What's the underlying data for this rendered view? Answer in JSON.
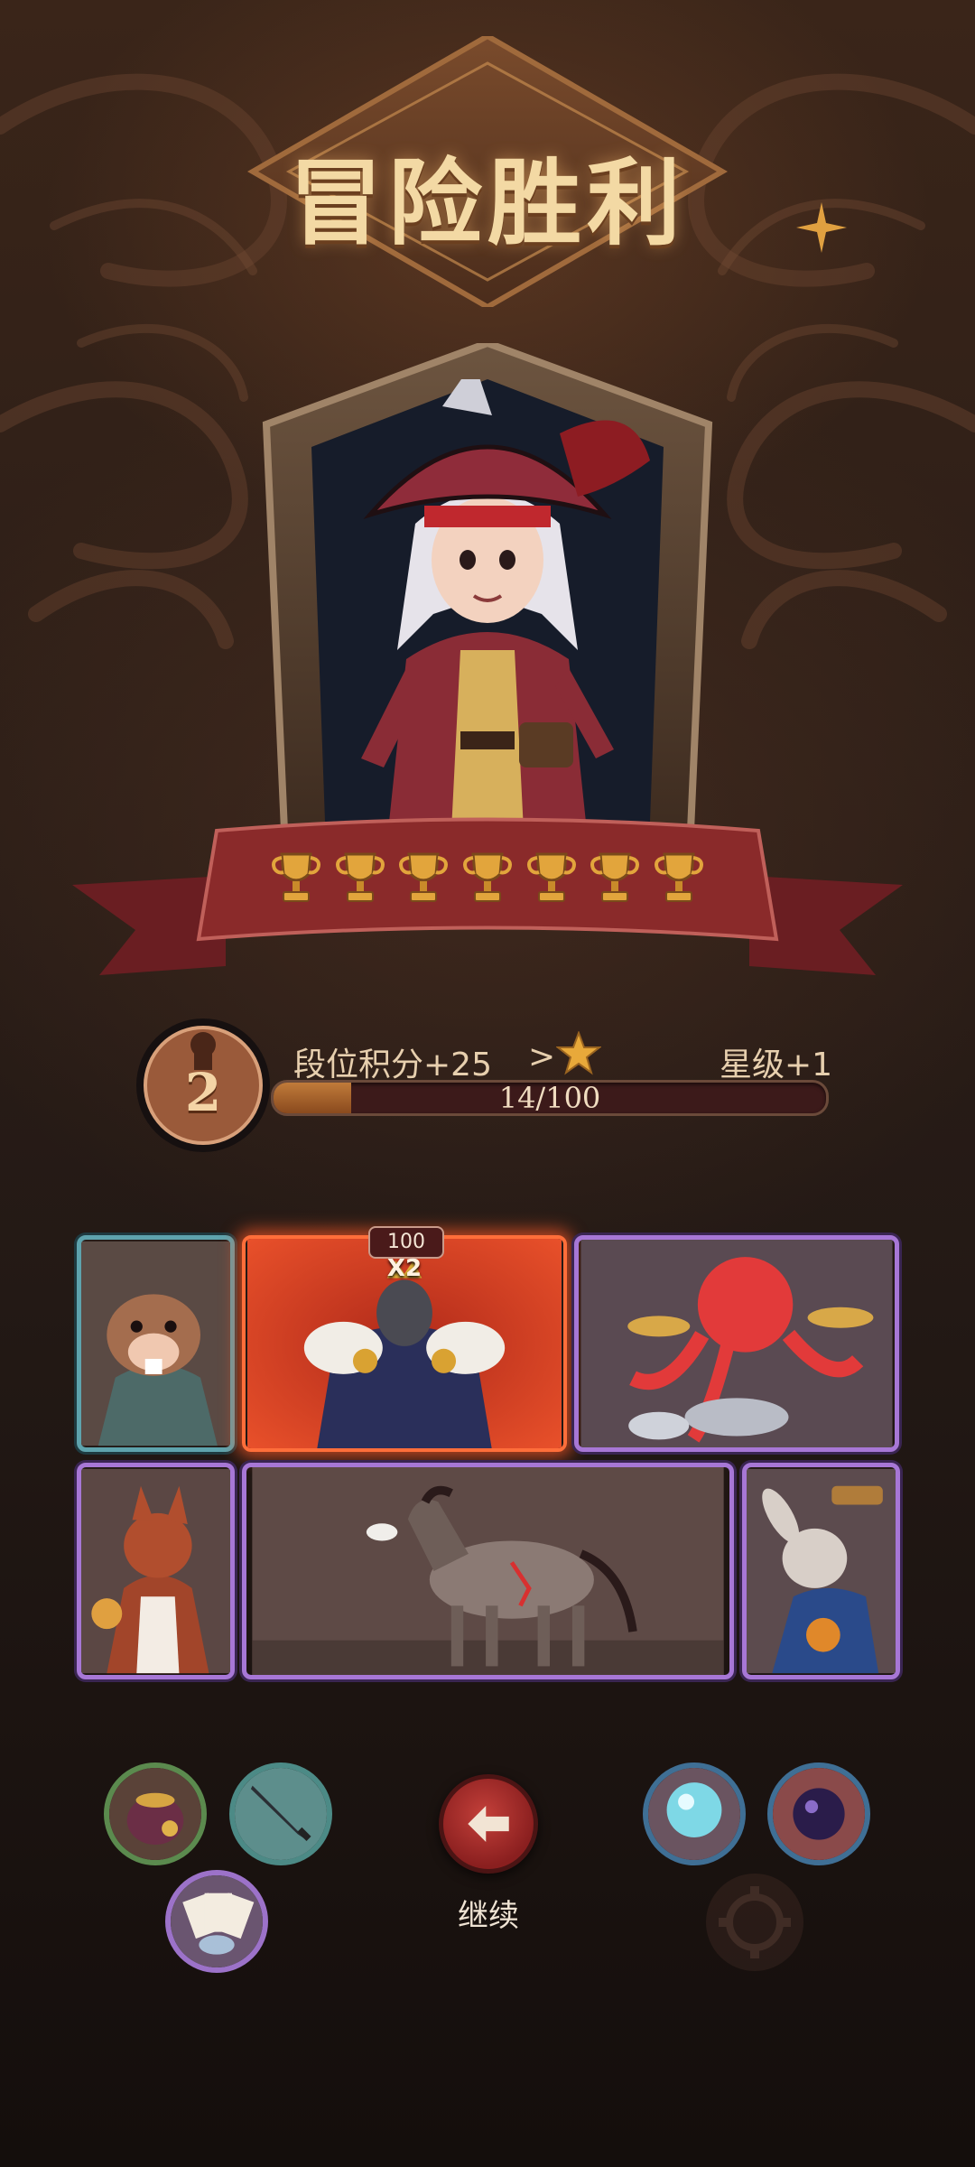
{
  "screen": {
    "title": "冒险胜利",
    "trophy_count": 7,
    "trophy_icon": "trophy-icon"
  },
  "rank": {
    "level": "2",
    "points_label": "段位积分+25",
    "arrow": ">",
    "star_level_label": "星级+1",
    "progress_text": "14/100",
    "progress_current": 14,
    "progress_max": 100
  },
  "cards": [
    {
      "id": "beaver",
      "rarity": "teal"
    },
    {
      "id": "minotaur",
      "rarity": "red",
      "level": "100",
      "multiplier": "X2"
    },
    {
      "id": "octopus",
      "rarity": "purple"
    },
    {
      "id": "squirrel",
      "rarity": "purple"
    },
    {
      "id": "horse",
      "rarity": "purple"
    },
    {
      "id": "rabbit",
      "rarity": "purple"
    }
  ],
  "relics_left": [
    "coin-bag-icon",
    "dagger-icon",
    "cards-icon"
  ],
  "relics_right": [
    "blue-orb-icon",
    "purple-orb-icon",
    "gear-icon"
  ],
  "continue": {
    "label": "继续",
    "icon": "arrow-left-icon"
  },
  "colors": {
    "title": "#f3d9a4",
    "ribbon": "#8a2a2a",
    "trophy": "#e2a53c",
    "teal_border": "#5ea3ad",
    "purple_border": "#a777d6",
    "red_glow": "#ff6e3a",
    "continue_button": "#b0302a"
  }
}
